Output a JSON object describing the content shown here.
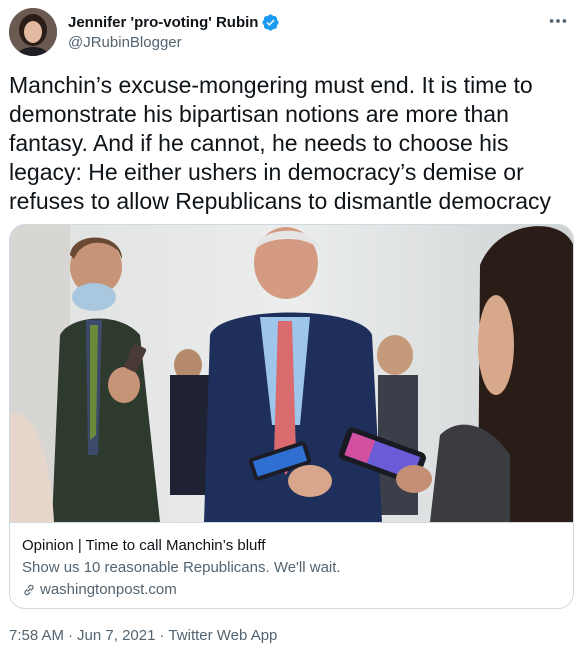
{
  "author": {
    "display_name": "Jennifer 'pro-voting' Rubin",
    "handle": "@JRubinBlogger",
    "verified_icon": "verified-badge-icon"
  },
  "tweet": {
    "text": "Manchin’s excuse-mongering must end. It is time to demonstrate his bipartisan notions are more than fantasy. And if he cannot, he needs to choose his legacy: He either ushers in democracy’s demise or refuses to allow Republicans to dismantle democracy"
  },
  "card": {
    "title": "Opinion | Time to call Manchin’s bluff",
    "description": "Show us 10 reasonable Republicans. We'll wait.",
    "domain": "washingtonpost.com"
  },
  "footer": {
    "time": "7:58 AM",
    "date": "Jun 7, 2021",
    "source": "Twitter Web App",
    "separator": "·"
  },
  "colors": {
    "text": "#0f1419",
    "secondary": "#536471",
    "border": "#cfd9de",
    "verified": "#1d9bf0"
  }
}
